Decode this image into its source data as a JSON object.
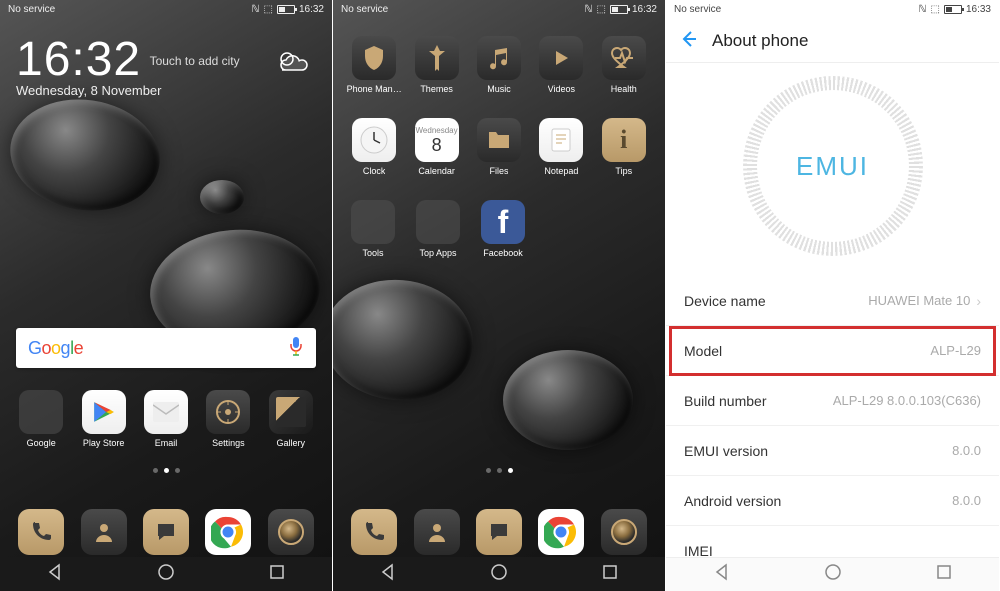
{
  "status": {
    "carrier": "No service",
    "time1": "16:32",
    "time2": "16:32",
    "time3": "16:33"
  },
  "home": {
    "time": "16:32",
    "add_city": "Touch to add city",
    "date": "Wednesday, 8 November",
    "search_brand": "Google",
    "row1": [
      "Google",
      "Play Store",
      "Email",
      "Settings",
      "Gallery"
    ],
    "dock": [
      "Phone",
      "Contacts",
      "Messages",
      "Chrome",
      "Camera"
    ]
  },
  "cal": {
    "wd": "Wednesday",
    "d": "8"
  },
  "apps": {
    "r1": [
      "Phone Man…",
      "Themes",
      "Music",
      "Videos",
      "Health"
    ],
    "r2": [
      "Clock",
      "Calendar",
      "Files",
      "Notepad",
      "Tips"
    ],
    "r3": [
      "Tools",
      "Top Apps",
      "Facebook"
    ]
  },
  "about": {
    "title": "About phone",
    "logo": "EMUI",
    "rows": [
      {
        "k": "Device name",
        "v": "HUAWEI Mate 10",
        "chev": true
      },
      {
        "k": "Model",
        "v": "ALP-L29"
      },
      {
        "k": "Build number",
        "v": "ALP-L29 8.0.0.103(C636)"
      },
      {
        "k": "EMUI version",
        "v": "8.0.0"
      },
      {
        "k": "Android version",
        "v": "8.0.0"
      },
      {
        "k": "IMEI",
        "v": ""
      }
    ]
  }
}
